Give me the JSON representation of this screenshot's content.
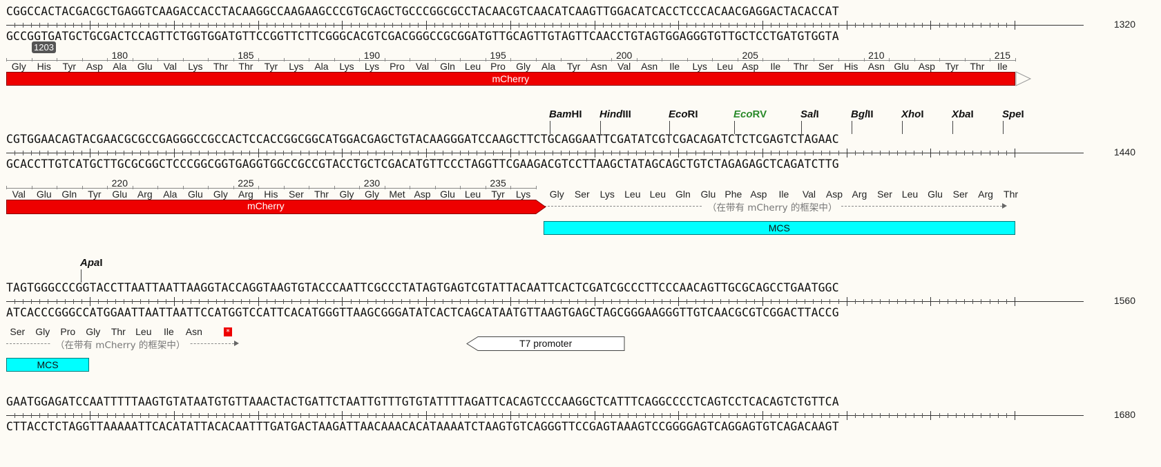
{
  "rows": [
    {
      "top": "CGGCCACTACGACGCTGAGGTCAAGACCACCTACAAGGCCAAGAAGCCCGTGCAGCTGCCCGGCGCCTACAACGTCAACATCAAGTTGGACATCACCTCCCACAACGAGGACTACACCAT",
      "bottom": "GCCGGTGATGCTGCGACTCCAGTTCTGGTGGATGTTCCGGTTCTTCGGGCACGTCGACGGGCCGCGGATGTTGCAGTTGTAGTTCAACCTGTAGTGGAGGGTGTTGCTCCTGATGTGGTA",
      "position": "1320"
    },
    {
      "top": "CGTGGAACAGTACGAACGCGCCGAGGGCCGCCACTCCACCGGCGGCATGGACGAGCTGTACAAGGGATCCAAGCTTCTGCAGGAATTCGATATCGTCGACAGATCTCTCGAGTCTAGAAC",
      "bottom": "GCACCTTGTCATGCTTGCGCGGCTCCCGGCGGTGAGGTGGCCGCCGTACCTGCTCGACATGTTCCCTAGGTTCGAAGACGTCCTTAAGCTATAGCAGCTGTCTAGAGAGCTCAGATCTTG",
      "position": "1440"
    },
    {
      "top": "TAGTGGGCCCGGTACCTTAATTAATTAAGGTACCAGGTAAGTGTACCCAATTCGCCCTATAGTGAGTCGTATTACAATTCACTCGATCGCCCTTCCCAACAGTTGCGCAGCCTGAATGGC",
      "bottom": "ATCACCCGGGCCATGGAATTAATTAATTCCATGGTCCATTCACATGGGTTAAGCGGGATATCACTCAGCATAATGTTAAGTGAGCTAGCGGGAAGGGTTGTCAACGCGTCGGACTTACCG",
      "position": "1560"
    },
    {
      "top": "GAATGGAGATCCAATTTTTAAGTGTATAATGTGTTAAACTACTGATTCTAATTGTTTGTGTATTTTAGATTCACAGTCCCAAGGCTCATTTCAGGCCCCTCAGTCCTCACAGTCTGTTCA",
      "bottom": "CTTACCTCTAGGTTAAAAATTCACATATTACACAATTTGATGACTAAGATTAACAAACACATAAAATCTAAGTGTCAGGGTTCCGAGTAAAGTCCGGGGAGTCAGGAGTGTCAGACAAGT",
      "position": "1680"
    }
  ],
  "cursor_badge": "1203",
  "translation1": {
    "aa": [
      "Gly",
      "His",
      "Tyr",
      "Asp",
      "Ala",
      "Glu",
      "Val",
      "Lys",
      "Thr",
      "Thr",
      "Tyr",
      "Lys",
      "Ala",
      "Lys",
      "Lys",
      "Pro",
      "Val",
      "Gln",
      "Leu",
      "Pro",
      "Gly",
      "Ala",
      "Tyr",
      "Asn",
      "Val",
      "Asn",
      "Ile",
      "Lys",
      "Leu",
      "Asp",
      "Ile",
      "Thr",
      "Ser",
      "His",
      "Asn",
      "Glu",
      "Asp",
      "Tyr",
      "Thr",
      "Ile"
    ],
    "numbers": [
      "180",
      "185",
      "190",
      "195",
      "200",
      "205",
      "210",
      "215"
    ]
  },
  "translation2": {
    "aa": [
      "Val",
      "Glu",
      "Gln",
      "Tyr",
      "Glu",
      "Arg",
      "Ala",
      "Glu",
      "Gly",
      "Arg",
      "His",
      "Ser",
      "Thr",
      "Gly",
      "Gly",
      "Met",
      "Asp",
      "Glu",
      "Leu",
      "Tyr",
      "Lys"
    ],
    "numbers": [
      "220",
      "225",
      "230",
      "235"
    ],
    "inframe_aa": [
      "Gly",
      "Ser",
      "Lys",
      "Leu",
      "Leu",
      "Gln",
      "Glu",
      "Phe",
      "Asp",
      "Ile",
      "Val",
      "Asp",
      "Arg",
      "Ser",
      "Leu",
      "Glu",
      "Ser",
      "Arg",
      "Thr"
    ]
  },
  "translation3": {
    "inframe_aa": [
      "Ser",
      "Gly",
      "Pro",
      "Gly",
      "Thr",
      "Leu",
      "Ile",
      "Asn"
    ],
    "stop_symbol": "*"
  },
  "inframe_label": "（在带有 mCherry 的框架中）",
  "features": {
    "mcherry1": "mCherry",
    "mcherry2": "mCherry",
    "mcs1": "MCS",
    "mcs2": "MCS",
    "t7": "T7 promoter"
  },
  "enzymes_row2": [
    {
      "italic": "Bam",
      "rest": "HI"
    },
    {
      "italic": "Hind",
      "rest": "III"
    },
    {
      "italic": "Eco",
      "rest": "RI"
    },
    {
      "italic": "Eco",
      "rest": "RV",
      "color": "green"
    },
    {
      "italic": "Sal",
      "rest": "I"
    },
    {
      "italic": "Bgl",
      "rest": "II"
    },
    {
      "italic": "Xho",
      "rest": "I"
    },
    {
      "italic": "Xba",
      "rest": "I"
    },
    {
      "italic": "Spe",
      "rest": "I"
    }
  ],
  "enzymes_row3": [
    {
      "italic": "Apa",
      "rest": "I"
    }
  ],
  "colors": {
    "mcherry": "#ee0000",
    "mcs": "#00ffff",
    "ecorv": "#2a8a2a",
    "background": "#fdfbf5"
  }
}
